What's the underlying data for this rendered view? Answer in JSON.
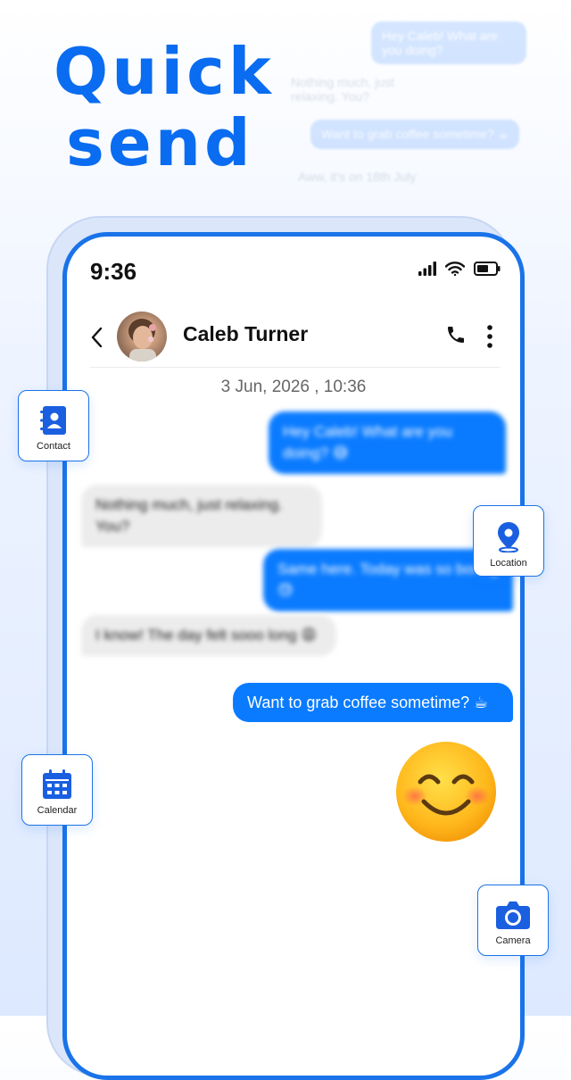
{
  "headline": {
    "line1": "Quick",
    "line2": "send"
  },
  "background_chat": [
    {
      "text": "Hey Caleb! What are you doing?",
      "kind": "sent"
    },
    {
      "text": "Nothing much, just relaxing. You?",
      "kind": "received"
    },
    {
      "text": "Want to grab coffee sometime? ☕",
      "kind": "sent"
    },
    {
      "text": "Aww, it's on 18th July",
      "kind": "received"
    }
  ],
  "status_bar": {
    "time": "9:36",
    "icons": [
      "signal-icon",
      "wifi-icon",
      "battery-icon"
    ]
  },
  "chat": {
    "contact_name": "Caleb Turner",
    "date": "3 Jun, 2026 , 10:36",
    "messages": [
      {
        "text": "Hey Caleb! What are you doing? 😅",
        "direction": "sent",
        "blurred": true
      },
      {
        "text": "Nothing much, just relaxing. You?",
        "direction": "received",
        "blurred": true
      },
      {
        "text": "Same here. Today was so boring 😓",
        "direction": "sent",
        "blurred": true
      },
      {
        "text": "I know! The day felt sooo long 😩",
        "direction": "received",
        "blurred": true
      },
      {
        "text": "Want to grab coffee sometime? ☕",
        "direction": "sent",
        "blurred": false
      }
    ],
    "large_emoji": "smiling-face-emoji"
  },
  "feature_cards": {
    "contact": "Contact",
    "location": "Location",
    "calendar": "Calendar",
    "camera": "Camera"
  },
  "colors": {
    "accent": "#1a73e8",
    "bubble_sent": "#0a7bff",
    "bubble_received": "#ececec",
    "headline": "#0a6cf0"
  }
}
